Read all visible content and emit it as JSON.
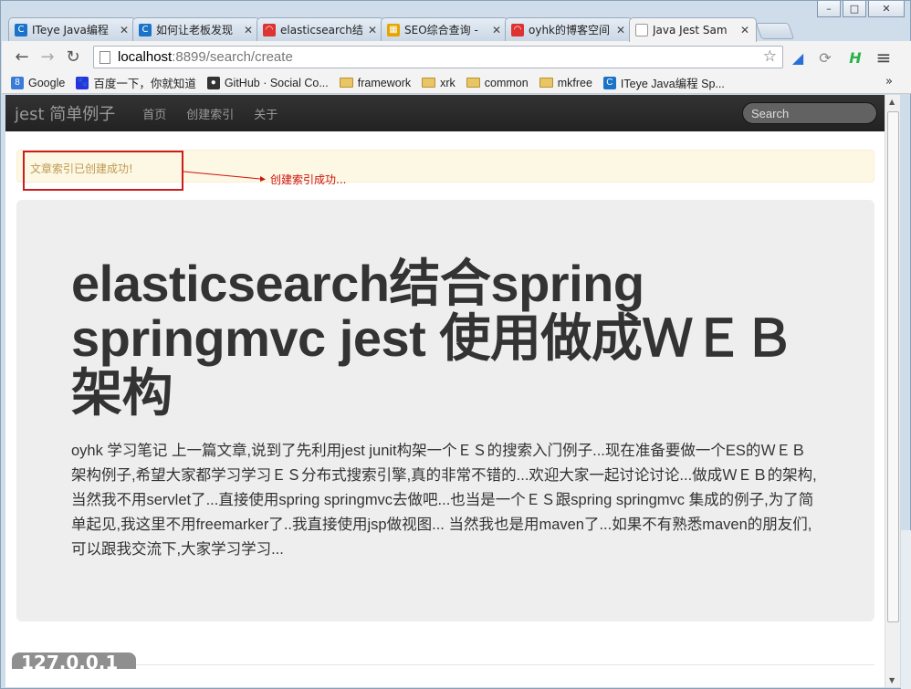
{
  "window": {
    "controls": {
      "minimize": "–",
      "maximize": "□",
      "close": "✕"
    }
  },
  "tabs": [
    {
      "title": "ITeye Java编程",
      "icon_color": "#1a73c8",
      "icon": "C"
    },
    {
      "title": "如何让老板发现",
      "icon_color": "#1a73c8",
      "icon": "C"
    },
    {
      "title": "elasticsearch结",
      "icon_color": "#d33",
      "icon": "◠"
    },
    {
      "title": "SEO综合查询 -",
      "icon_color": "#e6a400",
      "icon": "▦"
    },
    {
      "title": "oyhk的博客空间",
      "icon_color": "#d33",
      "icon": "◠"
    },
    {
      "title": "Java Jest Sam",
      "icon_color": "#ffffff",
      "icon": ""
    }
  ],
  "tab_close": "✕",
  "toolbar": {
    "back": "←",
    "forward": "→",
    "reload": "↻",
    "url_host": "localhost",
    "url_path": ":8899/search/create",
    "star": "☆",
    "menu": "≡"
  },
  "bookmarks": [
    {
      "label": "Google",
      "type": "site",
      "icon": "8",
      "color": "#3a7bd5"
    },
    {
      "label": "百度一下，你就知道",
      "type": "site",
      "icon": "🐾",
      "color": "#2932e1"
    },
    {
      "label": "GitHub · Social Co...",
      "type": "site",
      "icon": "●",
      "color": "#333333"
    },
    {
      "label": "framework",
      "type": "folder"
    },
    {
      "label": "xrk",
      "type": "folder"
    },
    {
      "label": "common",
      "type": "folder"
    },
    {
      "label": "mkfree",
      "type": "folder"
    },
    {
      "label": "ITeye Java编程 Sp...",
      "type": "site",
      "icon": "C",
      "color": "#1a73c8"
    }
  ],
  "bookmarks_more": "»",
  "navbar": {
    "brand": "jest 简单例子",
    "links": [
      "首页",
      "创建索引",
      "关于"
    ],
    "search_placeholder": "Search"
  },
  "alert": {
    "text": "文章索引已创建成功!",
    "annotation": "创建索引成功..."
  },
  "hero": {
    "title": "elasticsearch结合spring springmvc jest 使用做成ＷＥＢ架构",
    "body": "oyhk 学习笔记 上一篇文章,说到了先利用jest junit构架一个ＥＳ的搜索入门例子...现在准备要做一个ES的ＷＥＢ架构例子,希望大家都学习学习ＥＳ分布式搜索引擎,真的非常不错的...欢迎大家一起讨论讨论...做成ＷＥＢ的架构,当然我不用servlet了...直接使用spring springmvc去做吧...也当是一个ＥＳ跟spring springmvc 集成的例子,为了简单起见,我这里不用freemarker了..我直接使用jsp做视图... 当然我也是用maven了...如果不有熟悉maven的朋友们,可以跟我交流下,大家学习学习..."
  },
  "status": {
    "text": "127.0.0.1"
  }
}
